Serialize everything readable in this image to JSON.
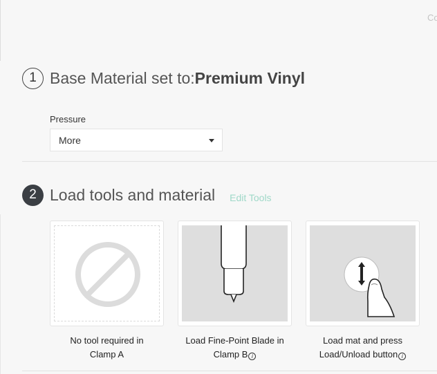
{
  "header": {
    "corner_text": "Co"
  },
  "step1": {
    "number": "1",
    "title_prefix": "Base Material set to:",
    "material": "Premium Vinyl",
    "pressure_label": "Pressure",
    "pressure_value": "More"
  },
  "step2": {
    "number": "2",
    "title": "Load tools and material",
    "edit_tools": "Edit Tools"
  },
  "cards": [
    {
      "icon": "no-tool-icon",
      "line1": "No tool required in",
      "line2": "Clamp A"
    },
    {
      "icon": "fine-point-blade-icon",
      "line1": "Load Fine-Point Blade in",
      "line2": "Clamp B"
    },
    {
      "icon": "press-load-button-icon",
      "line1": "Load mat and press",
      "line2": "Load/Unload button"
    }
  ],
  "info_glyph": "i",
  "colors": {
    "accent_link": "#9fd8c8",
    "step_fill": "#3b3f44",
    "background": "#f7f7f7"
  }
}
